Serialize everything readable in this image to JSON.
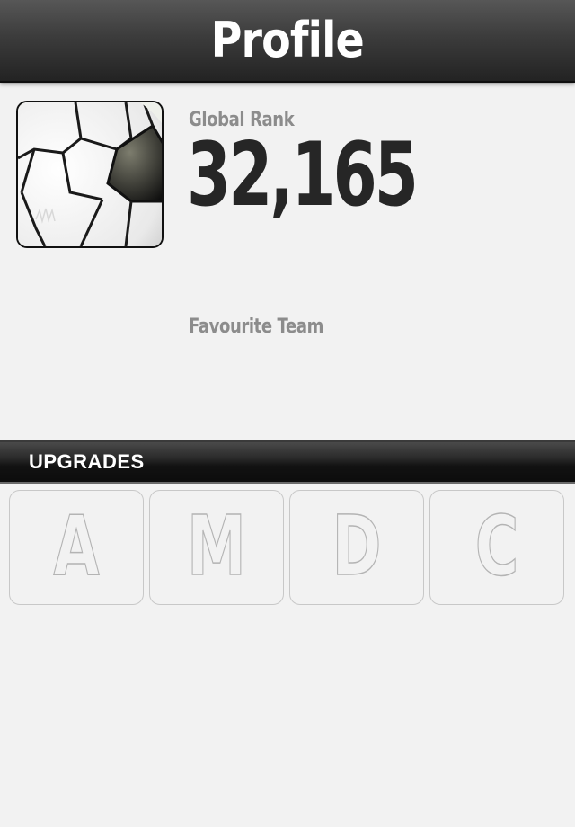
{
  "header": {
    "title": "Profile"
  },
  "profile": {
    "avatar_icon": "soccer-ball-icon",
    "rank_label": "Global Rank",
    "rank_value": "32,165",
    "team_label": "Favourite Team",
    "team_value": ""
  },
  "upgrades": {
    "title": "UPGRADES",
    "tiles": [
      {
        "letter": "A"
      },
      {
        "letter": "M"
      },
      {
        "letter": "D"
      },
      {
        "letter": "C"
      }
    ]
  },
  "colors": {
    "background": "#f2f2f2",
    "navbar": "#3c3c3c",
    "section_bar": "#121212",
    "rank_text": "#262626",
    "label_text": "#8c8c8c",
    "tile_outline": "#b4b4b4"
  }
}
